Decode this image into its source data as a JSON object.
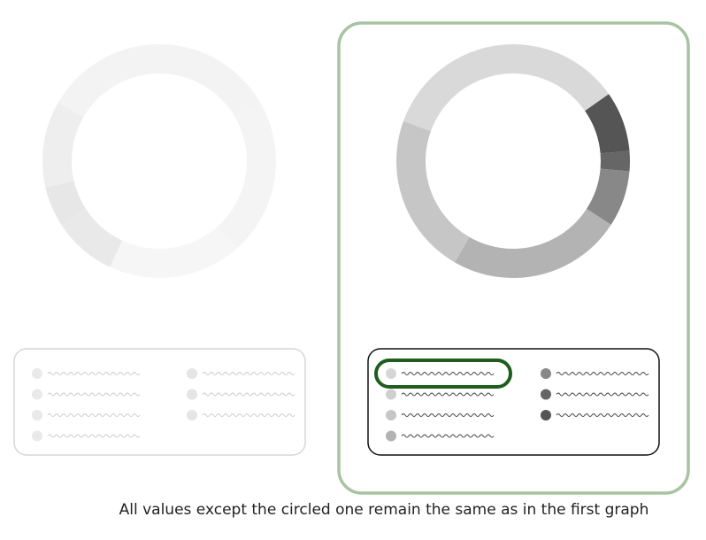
{
  "caption": "All values except the circled one remain the same as in the first graph",
  "colors": {
    "frame": "#a7c3a1",
    "highlight": "#1e5d1c",
    "legend_border_muted": "#d6d6d6",
    "legend_border": "#111111",
    "legend_line_muted": "#cccccc",
    "legend_line": "#444444"
  },
  "graphs": [
    {
      "variant": "before",
      "segments": [
        {
          "start": 0,
          "end": 60,
          "color": "#f3f3f3"
        },
        {
          "start": 60,
          "end": 138,
          "color": "#f4f4f4"
        },
        {
          "start": 138,
          "end": 205,
          "color": "#f6f6f6"
        },
        {
          "start": 205,
          "end": 237,
          "color": "#e9e9e9"
        },
        {
          "start": 237,
          "end": 257,
          "color": "#e7e7e7"
        },
        {
          "start": 257,
          "end": 300,
          "color": "#eeeeee"
        },
        {
          "start": 300,
          "end": 360,
          "color": "#f3f3f3"
        }
      ],
      "legend": [
        {
          "color": "#e9e9e9"
        },
        {
          "color": "#e9e9e9"
        },
        {
          "color": "#e9e9e9"
        },
        {
          "color": "#e9e9e9"
        },
        {
          "color": "#e5e5e5"
        },
        {
          "color": "#e5e5e5"
        },
        {
          "color": "#e5e5e5"
        }
      ]
    },
    {
      "variant": "after",
      "segments": [
        {
          "start": 0,
          "end": 55,
          "color": "#d9d9d9"
        },
        {
          "start": 55,
          "end": 85,
          "color": "#555555"
        },
        {
          "start": 85,
          "end": 95,
          "color": "#666666"
        },
        {
          "start": 95,
          "end": 123,
          "color": "#888888"
        },
        {
          "start": 123,
          "end": 210,
          "color": "#b3b3b3"
        },
        {
          "start": 210,
          "end": 290,
          "color": "#c6c6c6"
        },
        {
          "start": 290,
          "end": 360,
          "color": "#d9d9d9"
        }
      ],
      "legend": [
        {
          "color": "#d6d6d6"
        },
        {
          "color": "#d0d0d0"
        },
        {
          "color": "#c6c6c6"
        },
        {
          "color": "#b3b3b3"
        },
        {
          "color": "#888888"
        },
        {
          "color": "#666666"
        },
        {
          "color": "#555555"
        }
      ],
      "highlighted_legend_item": 0
    }
  ]
}
